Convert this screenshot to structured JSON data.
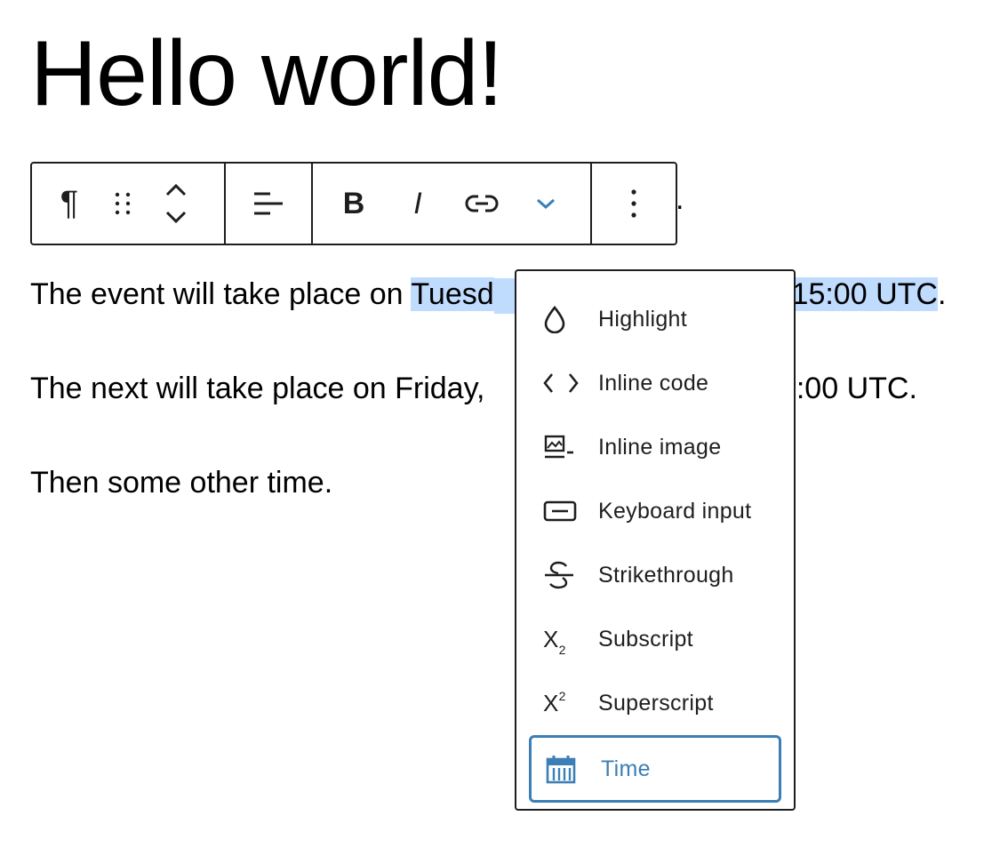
{
  "post": {
    "title": "Hello world!",
    "paragraphs": [
      {
        "before": "The event will take place on ",
        "selected": "Tuesd",
        "after_hidden_gap": "",
        "selected_tail": "t 15:00 UTC",
        "end": "."
      },
      {
        "before": "The next will take place on Friday, ",
        "tail": "7:00 UTC."
      },
      {
        "text": "Then some other time."
      }
    ],
    "toolbar_trailing_text": "."
  },
  "toolbar": {
    "paragraph_icon": "¶",
    "drag_icon": "drag-handle-icon",
    "move_icon": "chevron-up-down-icon",
    "align_icon": "align-left-icon",
    "bold_label": "B",
    "italic_label": "I",
    "link_icon": "link-icon",
    "more_formats_icon": "chevron-down-icon",
    "options_icon": "more-vertical-icon"
  },
  "menu": {
    "items": [
      {
        "label": "Highlight",
        "icon": "droplet-icon"
      },
      {
        "label": "Inline code",
        "icon": "code-icon"
      },
      {
        "label": "Inline image",
        "icon": "image-icon"
      },
      {
        "label": "Keyboard input",
        "icon": "keyboard-icon"
      },
      {
        "label": "Strikethrough",
        "icon": "strikethrough-icon"
      },
      {
        "label": "Subscript",
        "icon": "subscript-icon"
      },
      {
        "label": "Superscript",
        "icon": "superscript-icon"
      },
      {
        "label": "Time",
        "icon": "calendar-icon",
        "active": true
      }
    ],
    "subscript_glyph": "X",
    "subscript_small": "2",
    "superscript_glyph": "X",
    "superscript_small": "2"
  },
  "colors": {
    "accent": "#3b7fb6",
    "selection": "#bfdbfe",
    "border": "#1e1e1e"
  }
}
